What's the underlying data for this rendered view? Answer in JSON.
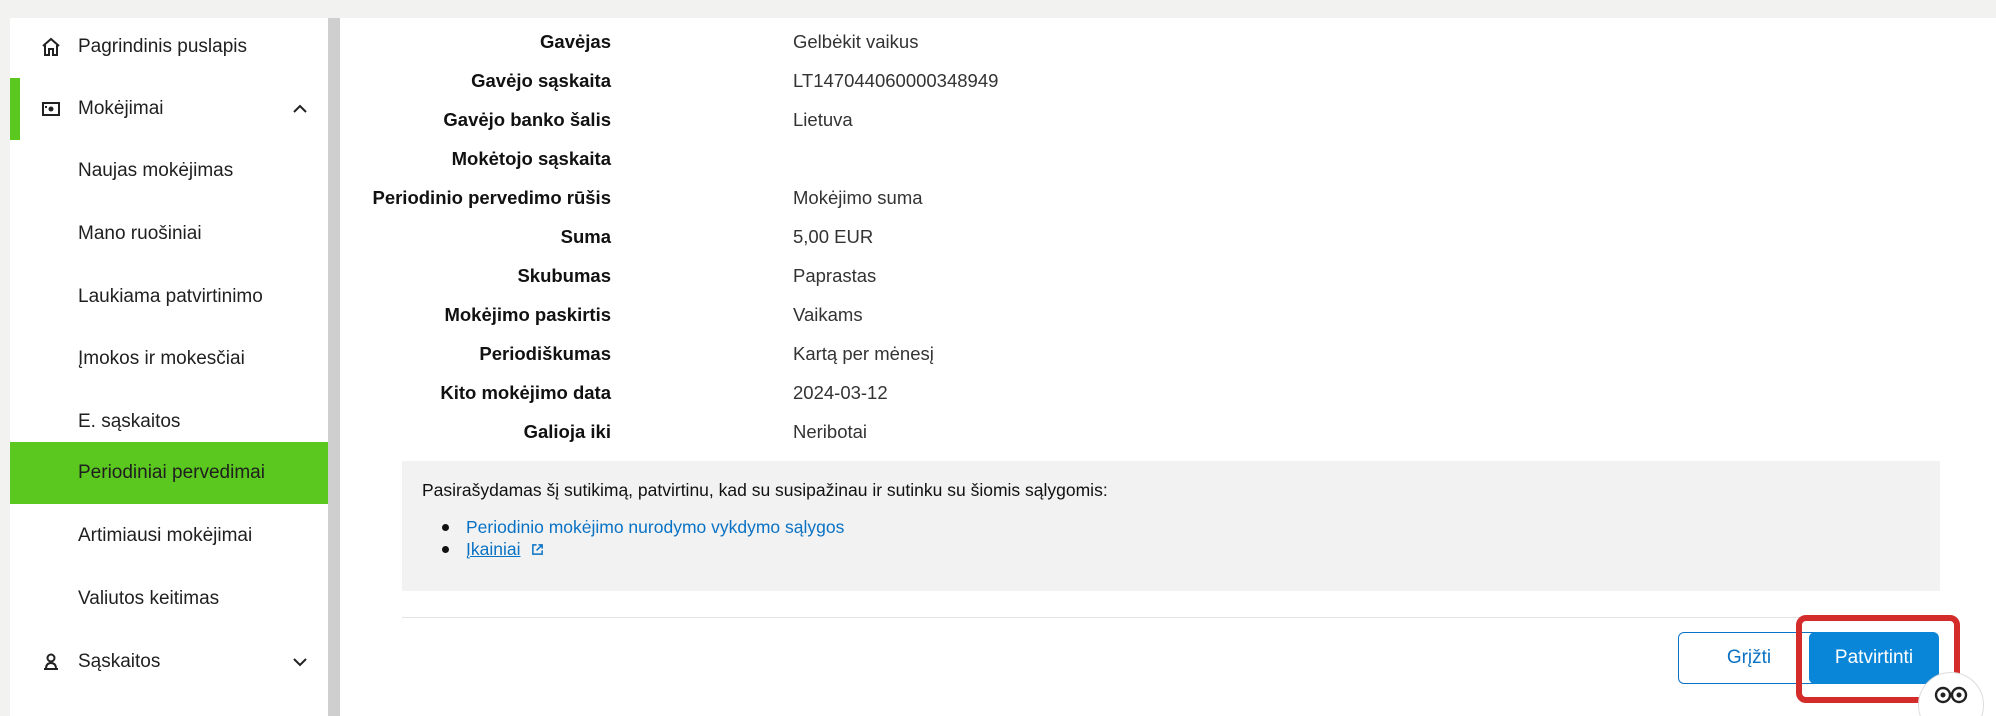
{
  "sidebar": {
    "items": [
      {
        "label": "Pagrindinis puslapis",
        "icon": "home-icon"
      },
      {
        "label": "Mokėjimai",
        "icon": "payments-icon"
      },
      {
        "label": "Naujas mokėjimas"
      },
      {
        "label": "Mano ruošiniai"
      },
      {
        "label": "Laukiama patvirtinimo"
      },
      {
        "label": "Įmokos ir mokesčiai"
      },
      {
        "label": "E. sąskaitos"
      },
      {
        "label": "Periodiniai pervedimai"
      },
      {
        "label": "Artimiausi mokėjimai"
      },
      {
        "label": "Valiutos keitimas"
      },
      {
        "label": "Sąskaitos",
        "icon": "accounts-icon"
      }
    ]
  },
  "details": [
    {
      "key": "Gavėjas",
      "value": "Gelbėkit vaikus"
    },
    {
      "key": "Gavėjo sąskaita",
      "value": "LT147044060000348949"
    },
    {
      "key": "Gavėjo banko šalis",
      "value": "Lietuva"
    },
    {
      "key": "Mokėtojo sąskaita",
      "value": ""
    },
    {
      "key": "Periodinio pervedimo rūšis",
      "value": "Mokėjimo suma"
    },
    {
      "key": "Suma",
      "value": "5,00 EUR"
    },
    {
      "key": "Skubumas",
      "value": "Paprastas"
    },
    {
      "key": "Mokėjimo paskirtis",
      "value": "Vaikams"
    },
    {
      "key": "Periodiškumas",
      "value": "Kartą per mėnesį"
    },
    {
      "key": "Kito mokėjimo data",
      "value": "2024-03-12"
    },
    {
      "key": "Galioja iki",
      "value": "Neribotai"
    }
  ],
  "consent": {
    "text": "Pasirašydamas šį sutikimą, patvirtinu, kad su susipažinau ir sutinku su šiomis sąlygomis:",
    "links": [
      "Periodinio mokėjimo nurodymo vykdymo sąlygos",
      "Įkainiai"
    ]
  },
  "buttons": {
    "back": "Grįžti",
    "confirm": "Patvirtinti"
  },
  "colors": {
    "accent_green": "#5ac81e",
    "link_blue": "#0a72c4",
    "button_blue": "#0a86d8",
    "highlight_red": "#d42b2b"
  }
}
